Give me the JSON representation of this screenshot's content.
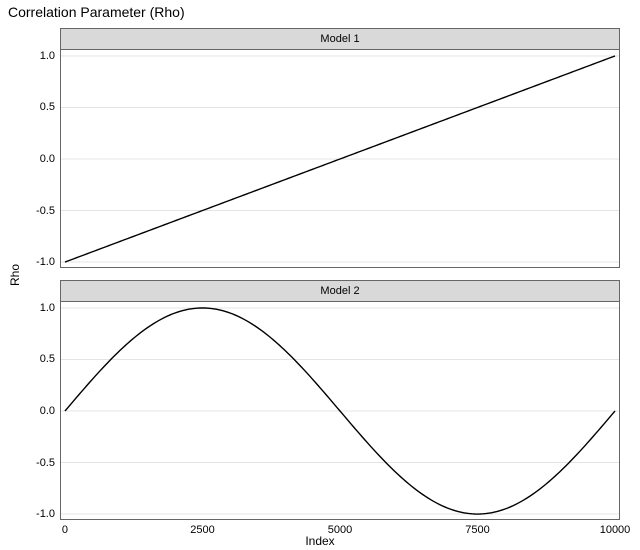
{
  "title": "Correlation Parameter (Rho)",
  "ylabel": "Rho",
  "xlabel": "Index",
  "panels": [
    {
      "strip": "Model 1"
    },
    {
      "strip": "Model 2"
    }
  ],
  "xticks": [
    "0",
    "2500",
    "5000",
    "7500",
    "10000"
  ],
  "yticks": [
    "-1.0",
    "-0.5",
    "0.0",
    "0.5",
    "1.0"
  ],
  "chart_data": {
    "type": "line",
    "title": "Correlation Parameter (Rho)",
    "xlabel": "Index",
    "ylabel": "Rho",
    "xlim": [
      0,
      10000
    ],
    "ylim": [
      -1.0,
      1.0
    ],
    "facets": [
      "Model 1",
      "Model 2"
    ],
    "series": [
      {
        "name": "Model 1",
        "facet": "Model 1",
        "formula": "rho = -1 + 2 * (index / 10000)",
        "x": [
          0,
          2500,
          5000,
          7500,
          10000
        ],
        "y": [
          -1.0,
          -0.5,
          0.0,
          0.5,
          1.0
        ]
      },
      {
        "name": "Model 2",
        "facet": "Model 2",
        "formula": "rho = sin(2 * pi * index / 10000)",
        "x": [
          0,
          1250,
          2500,
          3750,
          5000,
          6250,
          7500,
          8750,
          10000
        ],
        "y": [
          0.0,
          0.707,
          1.0,
          0.707,
          0.0,
          -0.707,
          -1.0,
          -0.707,
          0.0
        ]
      }
    ]
  }
}
